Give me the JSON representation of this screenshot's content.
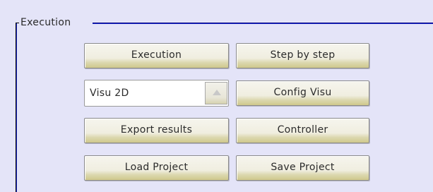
{
  "group": {
    "title": "Execution"
  },
  "buttons": {
    "execution": "Execution",
    "step_by_step": "Step by step",
    "config_visu": "Config Visu",
    "export_results": "Export results",
    "controller": "Controller",
    "load_project": "Load Project",
    "save_project": "Save Project"
  },
  "visu_select": {
    "selected": "Visu 2D",
    "arrow_icon": "triangle-up-icon"
  },
  "colors": {
    "background": "#e4e4f8",
    "group_border": "#1c28c8",
    "button_face": "#f0eee0",
    "button_bottom": "#cfc88c"
  }
}
